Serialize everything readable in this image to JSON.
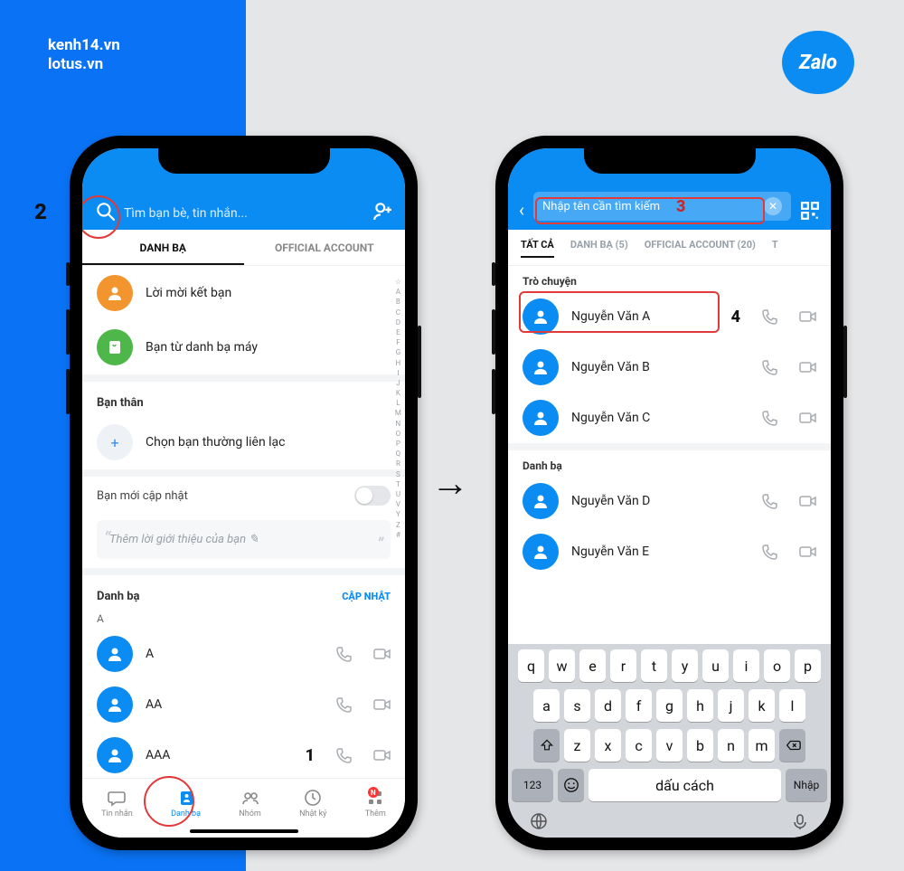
{
  "site": {
    "line1": "kenh14.vn",
    "line2": "lotus.vn"
  },
  "zalo": {
    "label": "Zalo"
  },
  "steps": {
    "s1": "1",
    "s2": "2",
    "s3": "3",
    "s4": "4"
  },
  "screen1": {
    "search_placeholder": "Tìm bạn bè, tin nhắn...",
    "tabs": {
      "contacts": "DANH BẠ",
      "oa": "OFFICIAL ACCOUNT"
    },
    "friend_request": "Lời mời kết bạn",
    "phone_contacts": "Bạn từ danh bạ máy",
    "close_friends_header": "Bạn thân",
    "choose_close": "Chọn bạn thường liên lạc",
    "recently_updated": "Bạn mới cập nhật",
    "intro_placeholder": "Thêm lời giới thiệu của bạn ✎",
    "contacts_header": "Danh bạ",
    "update_btn": "CẬP NHẬT",
    "letter_a": "A",
    "contacts": [
      {
        "name": "A"
      },
      {
        "name": "AA"
      },
      {
        "name": "AAA"
      }
    ],
    "bottom_nav": {
      "messages": "Tin nhắn",
      "contacts": "Danh bạ",
      "groups": "Nhóm",
      "diary": "Nhật ký",
      "more": "Thêm",
      "badge": "N"
    },
    "alpha": "☆ A B C D E F G H I J K L M N O P Q R S T U V Y Z #"
  },
  "screen2": {
    "search_placeholder": "Nhập tên cần tìm kiếm",
    "filter_tabs": {
      "all": "TẤT CẢ",
      "contacts": "DANH BẠ (5)",
      "oa": "OFFICIAL ACCOUNT (20)",
      "more": "T"
    },
    "chat_label": "Trò chuyện",
    "contacts_label": "Danh bạ",
    "results_chat": [
      {
        "name": "Nguyễn Văn A"
      },
      {
        "name": "Nguyễn Văn B"
      },
      {
        "name": "Nguyễn Văn C"
      }
    ],
    "results_contacts": [
      {
        "name": "Nguyễn Văn D"
      },
      {
        "name": "Nguyễn Văn E"
      }
    ],
    "keyboard": {
      "r1": [
        "q",
        "w",
        "e",
        "r",
        "t",
        "y",
        "u",
        "i",
        "o",
        "p"
      ],
      "r2": [
        "a",
        "s",
        "d",
        "f",
        "g",
        "h",
        "j",
        "k",
        "l"
      ],
      "r3": [
        "z",
        "x",
        "c",
        "v",
        "b",
        "n",
        "m"
      ],
      "num": "123",
      "space": "dấu cách",
      "enter": "Nhập"
    }
  }
}
